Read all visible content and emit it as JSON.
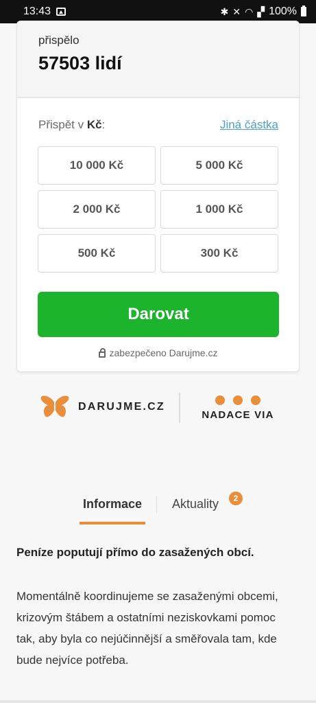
{
  "status_bar": {
    "time": "13:43",
    "battery": "100%",
    "icons": [
      "image-icon",
      "bluetooth-icon",
      "mute-icon",
      "wifi-icon",
      "signal-icon",
      "battery-icon"
    ]
  },
  "stats": {
    "contributed_label": "přispělo",
    "contributed_value": "57503 lidí"
  },
  "donation": {
    "label_prefix": "Přispět v ",
    "currency": "Kč",
    "label_suffix": ":",
    "other_amount": "Jiná částka",
    "amounts": [
      "10 000 Kč",
      "5 000 Kč",
      "2 000 Kč",
      "1 000 Kč",
      "500 Kč",
      "300 Kč"
    ],
    "donate_button": "Darovat",
    "secured_text": "zabezpečeno Darujme.cz",
    "accent_color": "#1db42d"
  },
  "logos": {
    "darujme": "DARUJME.CZ",
    "via": "NADACE VIA",
    "brand_color": "#e98f3c"
  },
  "tabs": {
    "info": "Informace",
    "news": "Aktuality",
    "news_badge": "2"
  },
  "content": {
    "headline": "Peníze poputují přímo do zasažených obcí.",
    "paragraph": "Momentálně koordinujeme se zasaženými obcemi, krizovým štábem a ostatními neziskovkami pomoc tak, aby byla co nejúčinnější a směřovala tam, kde bude nejvíce potřeba."
  }
}
